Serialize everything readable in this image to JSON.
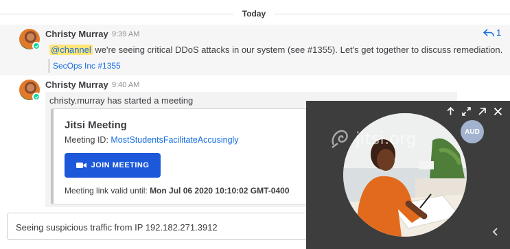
{
  "date_separator": "Today",
  "posts": [
    {
      "username": "Christy Murray",
      "time": "9:39 AM",
      "mention": "@channel",
      "message": " we're seeing critical DDoS attacks in our system (see #1355). Let's get together to discuss remediation.",
      "reply_count": "1",
      "channel_link": "SecOps Inc #1355"
    },
    {
      "username": "Christy Murray",
      "time": "9:40 AM",
      "message": "christy.murray has started a meeting",
      "card": {
        "title": "Jitsi Meeting",
        "meeting_id_label": "Meeting ID: ",
        "meeting_id_value": "MostStudentsFacilitateAccusingly",
        "join_button": "JOIN MEETING",
        "valid_label": "Meeting link valid until: ",
        "valid_value": "Mon Jul 06 2020 10:10:02 GMT-0400"
      }
    }
  ],
  "composer": {
    "value": "Seeing suspicious traffic from IP 192.182.271.3912"
  },
  "jitsi_window": {
    "watermark": "jitsi.org",
    "audio_badge": "AUD"
  },
  "colors": {
    "link": "#166de0",
    "button": "#1c58d9",
    "online": "#06d6a0",
    "mention_highlight": "#ffe577",
    "jitsi_bg": "#3d3d3d"
  },
  "icons": {
    "reply": "reply-arrow-icon",
    "status": "check-icon",
    "video": "video-camera-icon",
    "jitsi_controls": [
      "arrow-up-icon",
      "expand-icon",
      "external-open-icon",
      "close-icon"
    ],
    "collapse": "chevron-left-icon"
  }
}
